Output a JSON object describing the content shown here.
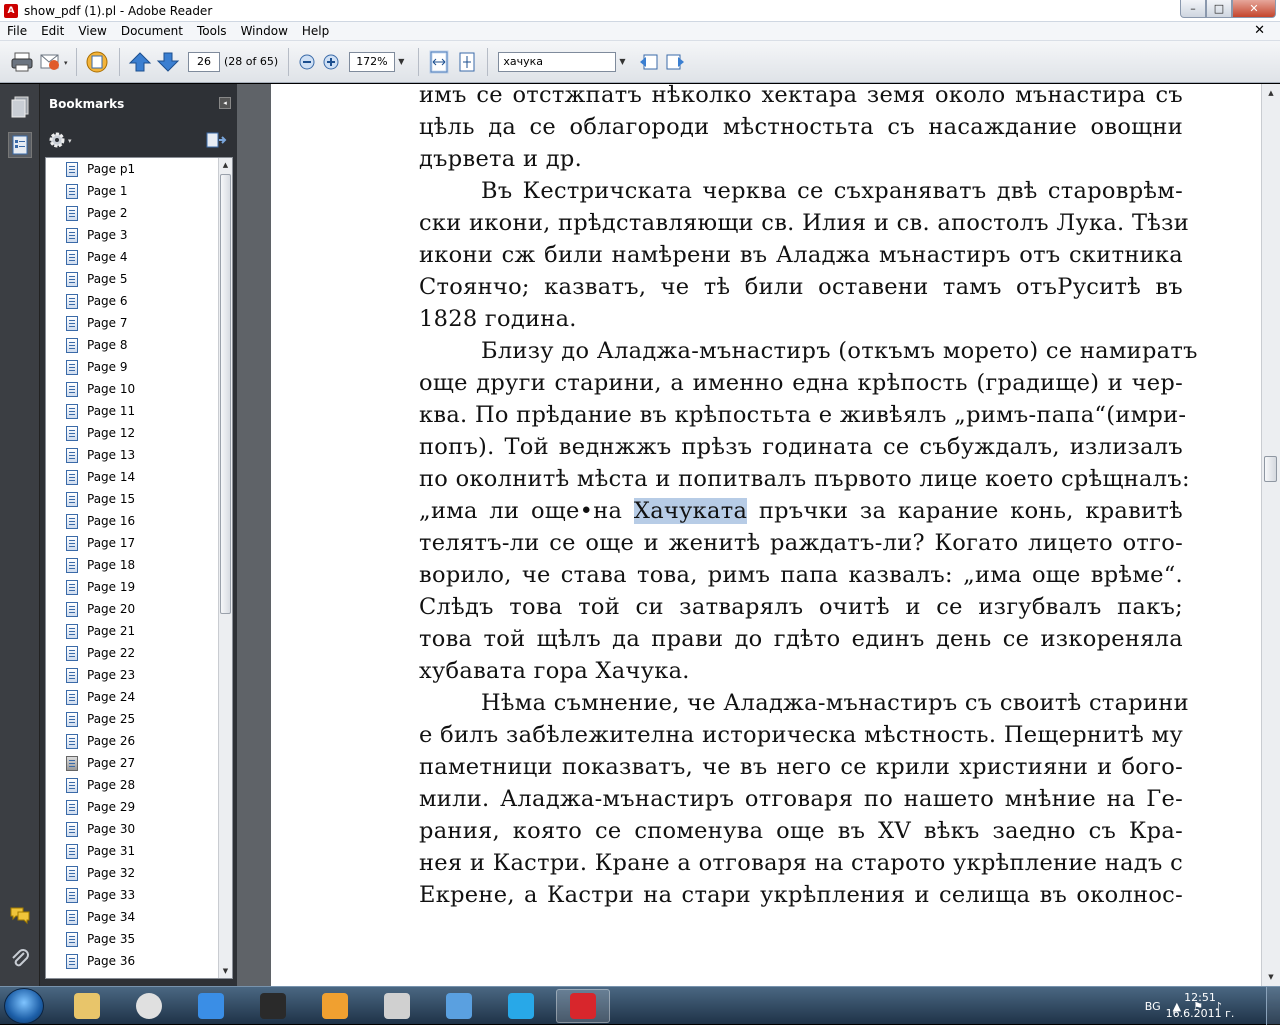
{
  "window": {
    "title": "show_pdf (1).pl - Adobe Reader",
    "app_icon": "adobe-reader-icon",
    "min": "–",
    "max": "□",
    "close": "✕"
  },
  "menu": [
    "File",
    "Edit",
    "View",
    "Document",
    "Tools",
    "Window",
    "Help"
  ],
  "menu_close": "✕",
  "toolbar": {
    "page_number": "26",
    "page_count": "(28 of 65)",
    "zoom": "172%",
    "search_value": "хачука"
  },
  "bookmarks": {
    "title": "Bookmarks",
    "items": [
      "Page p1",
      "Page 1",
      "Page 2",
      "Page 3",
      "Page 4",
      "Page 5",
      "Page 6",
      "Page 7",
      "Page 8",
      "Page 9",
      "Page 10",
      "Page 11",
      "Page 12",
      "Page 13",
      "Page 14",
      "Page 15",
      "Page 16",
      "Page 17",
      "Page 18",
      "Page 19",
      "Page 20",
      "Page 21",
      "Page 22",
      "Page 23",
      "Page 24",
      "Page 25",
      "Page 26",
      "Page 27",
      "Page 28",
      "Page 29",
      "Page 30",
      "Page 31",
      "Page 32",
      "Page 33",
      "Page 34",
      "Page 35",
      "Page 36"
    ],
    "selected_index": 27
  },
  "document": {
    "lines": [
      "имъ се отстжпатъ нѣколко хектара земя около мънастира съ",
      "цѣль да се облагороди мѣстностьта съ насаждание овощни",
      "дървета и др.",
      "Въ Кестричската черква се съхраняватъ двѣ староврѣм-",
      "ски икони, прѣдставляющи св. Илия и св. апостолъ Лука. Тѣзи",
      "икони сж били намѣрени въ Аладжа мънастиръ отъ скитника",
      "Стоянчо; казватъ, че тѣ били оставени тамъ отъРуситѣ въ",
      "1828 година.",
      "Близу до Аладжа-мънастиръ (откъмъ морето) се намиратъ",
      "още други старини, а именно една крѣпость (градище) и чер-",
      "ква. По прѣдание въ крѣпостьта е живѣялъ „римъ-папа“(имри-",
      "попъ). Той веднжжъ прѣзъ годината се събуждалъ, излизалъ",
      "по околнитѣ мѣста и попитвалъ първото лице което срѣщналъ:",
      "„има ли още•на",
      "Хачуката",
      "пръчки за карание конь, кравитѣ",
      "телятъ-ли се още и женитѣ раждатъ-ли? Когато лицето отго-",
      "ворило, че става това, римъ папа казвалъ: „има още врѣме“.",
      "Слѣдъ това той си затварялъ очитѣ и се изгубвалъ пакъ;",
      "това той щѣлъ да прави до гдѣто единъ день се изкореняла",
      "хубавата гора Хачука.",
      "Нѣма съмнение, че Аладжа-мънастиръ съ своитѣ старини",
      "е билъ забѣлежителна историческа мѣстность. Пещернитѣ му",
      "паметници показватъ, че въ него се крили християни и бого-",
      "мили. Аладжа-мънастиръ отговаря по нашето мнѣние на Ге-",
      "рания, която се споменува още въ XV вѣкъ заедно съ Кра-",
      "нея и Кастри. Кране а отговаря на старото укрѣпление надъ с",
      "Екрене, а Кастри на стари укрѣпления и селища въ околнос-"
    ]
  },
  "taskbar": {
    "apps": [
      "file-explorer-icon",
      "chrome-icon",
      "internet-explorer-icon",
      "text-tool-icon",
      "media-player-icon",
      "notepad-icon",
      "messenger-icon",
      "skype-icon",
      "adobe-reader-icon"
    ],
    "tray_lang": "BG",
    "time": "12:51",
    "date": "16.6.2011 г."
  },
  "colors": {
    "highlight": "#b7cce6",
    "panel": "#2e3136",
    "toolbar": "#e4e7eb"
  }
}
